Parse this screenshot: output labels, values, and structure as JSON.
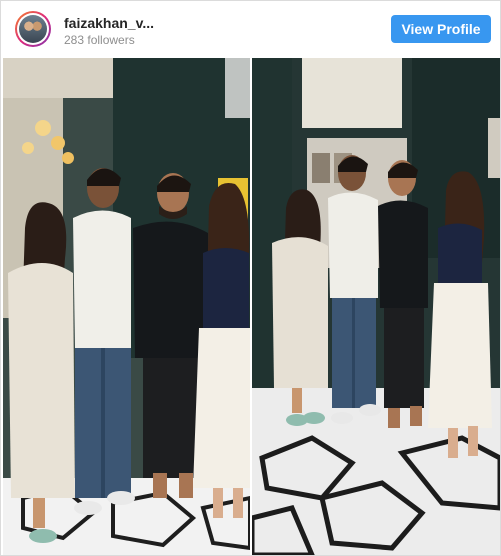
{
  "post": {
    "username": "faizakhan_v...",
    "followers": "283 followers",
    "view_profile_label": "View Profile"
  },
  "colors": {
    "button_bg": "#3897f0",
    "username": "#262626",
    "followers": "#8e8e8e"
  },
  "icons": {
    "avatar": "profile-avatar"
  }
}
